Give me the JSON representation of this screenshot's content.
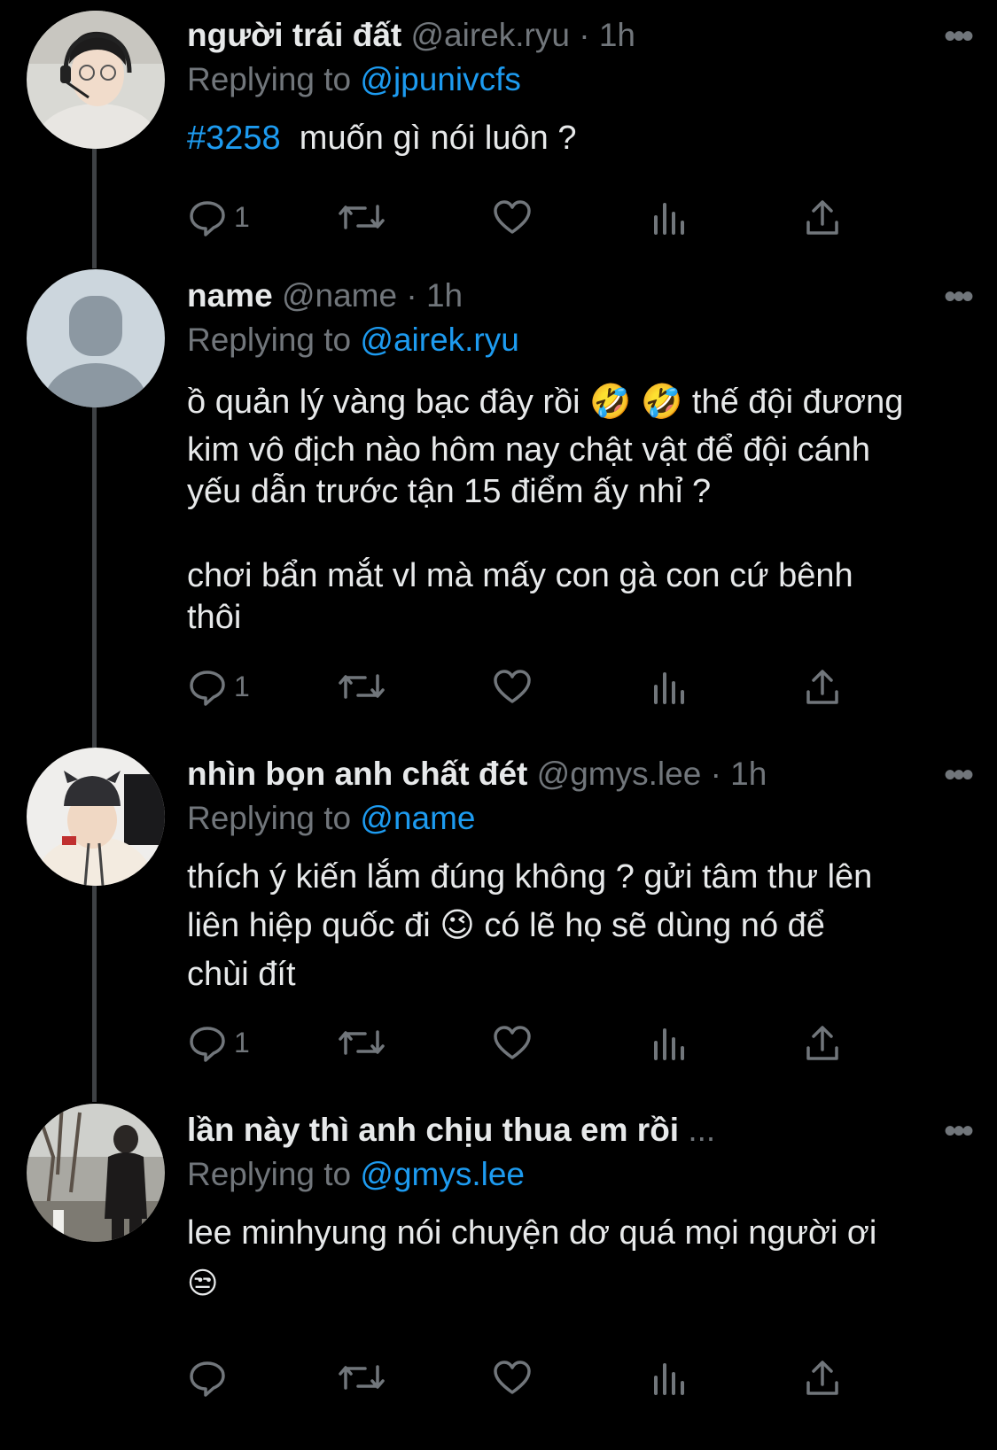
{
  "tweets": [
    {
      "name": "người trái đất",
      "handle": "@airek.ryu",
      "dot": "·",
      "time": "1h",
      "replying_prefix": "Replying to",
      "replying_to": "@jpunivcfs",
      "hashtag": "#3258",
      "text_lines": [
        "muốn gì nói luôn ?"
      ],
      "reply_count": "1",
      "avatar": "person-with-headset"
    },
    {
      "name": "name",
      "handle": "@name",
      "dot": "·",
      "time": "1h",
      "replying_prefix": "Replying to",
      "replying_to": "@airek.ryu",
      "text_lines": [
        "ồ quản lý vàng bạc đây rồi 🤣 🤣  thế đội đương",
        "kim vô địch nào hôm nay chật vật để đội cánh",
        "yếu dẫn trước tận 15 điểm ấy nhỉ ?",
        "",
        "chơi bẩn mắt vl mà mấy con gà con cứ bênh",
        "thôi"
      ],
      "reply_count": "1",
      "avatar": "default-avatar"
    },
    {
      "name": "nhìn bọn anh chất đét",
      "handle": "@gmys.lee",
      "dot": "·",
      "time": "1h",
      "replying_prefix": "Replying to",
      "replying_to": "@name",
      "text_lines": [
        "thích ý kiến lắm đúng không ? gửi tâm thư lên",
        "liên hiệp quốc đi 😉  có lẽ họ sẽ dùng nó để",
        "chùi đít"
      ],
      "reply_count": "1",
      "avatar": "person-with-beanie"
    },
    {
      "name": "lần này thì anh chịu thua em rồi",
      "ellipsis": "...",
      "replying_prefix": "Replying to",
      "replying_to": "@gmys.lee",
      "text_lines": [
        "lee minhyung nói chuyện dơ quá mọi người ơi",
        "😒"
      ],
      "avatar": "person-outdoors"
    }
  ],
  "more_glyph": "•••",
  "icons": [
    "reply-icon",
    "retweet-icon",
    "like-icon",
    "views-icon",
    "share-icon"
  ],
  "colors": {
    "background": "#000000",
    "text": "#e7e9ea",
    "muted": "#71767b",
    "link": "#1d9bf0",
    "thread_line": "#3e4144"
  }
}
